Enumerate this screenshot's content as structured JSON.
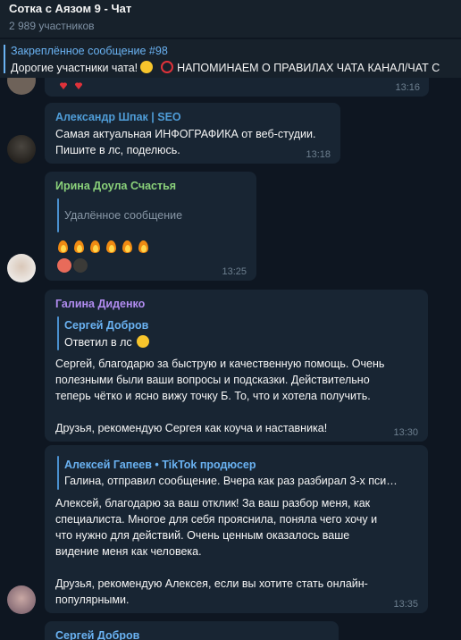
{
  "header": {
    "title": "Сотка с Аязом 9 - Чат",
    "subtitle": "2 989 участников"
  },
  "pinned": {
    "title": "Закреплённое сообщение #98",
    "text_before": "Дорогие участники чата!",
    "text_after": "НАПОМИНАЕМ О ПРАВИЛАХ ЧАТА  КАНАЛ/ЧАТ С"
  },
  "messages": [
    {
      "time": "13:16"
    },
    {
      "sender": "Александр Шпак | SEO",
      "lines": [
        "Самая актуальная ИНФОГРАФИКА от веб-студии.",
        "Пишите в лс, поделюсь."
      ],
      "time": "13:18"
    },
    {
      "sender": "Ирина Доула Счастья",
      "deleted": "Удалённое сообщение",
      "time": "13:25"
    },
    {
      "sender": "Галина Диденко",
      "reply_name": "Сергей Добров",
      "reply_text": "Ответил в лс",
      "lines": [
        "Сергей, благодарю за быструю и качественную помощь. Очень",
        "полезными были ваши вопросы и подсказки. Действительно",
        "теперь чётко и ясно вижу точку Б. То, что и хотела получить.",
        "",
        "Друзья,  рекомендую Сергея как коуча и наставника!"
      ],
      "time": "13:30"
    },
    {
      "reply_name": "Алексей Гапеев • TikTok продюсер",
      "reply_text": "Галина, отправил сообщение. Вчера как раз разбирал 3-х пси…",
      "lines": [
        "Алексей,  благодарю за ваш отклик! За ваш разбор меня, как",
        "специалиста.  Многое для себя прояснила, поняла чего хочу и",
        "что нужно для действий. Очень ценным оказалось ваше",
        "видение меня как человека.",
        "",
        "Друзья,  рекомендую Алексея, если вы хотите стать онлайн-",
        "популярными."
      ],
      "time": "13:35"
    },
    {
      "sender": "Сергей Добров"
    }
  ],
  "colors": {
    "background": "#0e1621",
    "bubble": "#182533",
    "header": "#17212b",
    "accent": "#6ab2f2",
    "name_aleksandr": "#4f9dd8",
    "name_irina": "#8ad17a",
    "name_galina": "#b18cf0"
  }
}
